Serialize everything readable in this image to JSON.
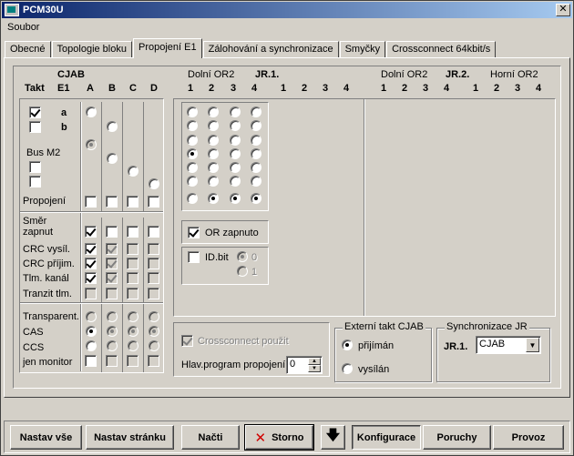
{
  "window": {
    "title": "PCM30U"
  },
  "menu": {
    "file": "Soubor"
  },
  "tabs": [
    "Obecné",
    "Topologie bloku",
    "Propojení E1",
    "Zálohování a synchronizace",
    "Smyčky",
    "Crossconnect 64kbit/s"
  ],
  "active_tab": 2,
  "left": {
    "header_takt": "Takt",
    "header_cjab": "CJAB",
    "header_e1": "E1",
    "cols": [
      "A",
      "B",
      "C",
      "D"
    ],
    "row_a": "a",
    "row_b": "b",
    "bus_m2": "Bus M2",
    "propojeni": "Propojení",
    "smer_1": "Směr",
    "smer_2": "zapnut",
    "crc_vysil": "CRC vysíl.",
    "crc_prijim": "CRC příjim.",
    "tlm_kanal": "Tlm. kanál",
    "tranzit": "Tranzit tlm.",
    "transparent": "Transparent.",
    "cas": "CAS",
    "ccs": "CCS",
    "jen_monitor": "jen monitor"
  },
  "jr1": {
    "dolni_or2": "Dolní OR2",
    "title": "JR.1.",
    "cols_left": [
      "1",
      "2",
      "3",
      "4"
    ],
    "cols_right": [
      "1",
      "2",
      "3",
      "4"
    ],
    "or_zapnuto": "OR zapnuto",
    "id_bit": "ID.bit",
    "id_0": "0",
    "id_1": "1"
  },
  "jr2": {
    "dolni_or2": "Dolní OR2",
    "title": "JR.2.",
    "horni_or2": "Horní OR2",
    "cols_left": [
      "1",
      "2",
      "3",
      "4"
    ],
    "cols_right": [
      "1",
      "2",
      "3",
      "4"
    ]
  },
  "crossconnect": {
    "used": "Crossconnect použit",
    "main_program": "Hlav.program propojení",
    "main_program_value": "0"
  },
  "external_clock": {
    "title": "Externí takt CJAB",
    "received": "přijímán",
    "sent": "vysílán"
  },
  "sync": {
    "title": "Synchronizace  JR",
    "label": "JR.1.",
    "value": "CJAB"
  },
  "buttons": {
    "set_all": "Nastav vše",
    "set_page": "Nastav stránku",
    "load": "Načti",
    "cancel": "Storno",
    "config": "Konfigurace",
    "faults": "Poruchy",
    "operation": "Provoz"
  }
}
